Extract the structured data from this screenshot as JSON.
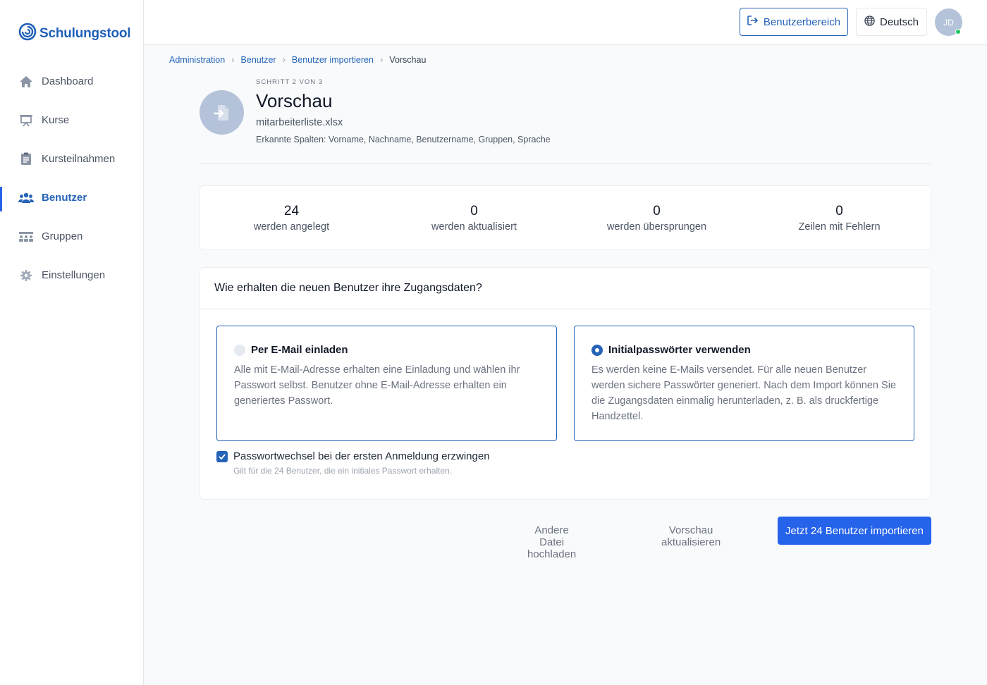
{
  "app": {
    "name": "Schulungstool"
  },
  "sidebar": {
    "items": [
      {
        "label": "Dashboard",
        "icon": "home-icon"
      },
      {
        "label": "Kurse",
        "icon": "presentation-icon"
      },
      {
        "label": "Kursteilnahmen",
        "icon": "clipboard-icon"
      },
      {
        "label": "Benutzer",
        "icon": "users-icon",
        "active": true
      },
      {
        "label": "Gruppen",
        "icon": "groups-icon"
      },
      {
        "label": "Einstellungen",
        "icon": "gear-icon"
      }
    ]
  },
  "topbar": {
    "user_area_label": "Benutzerbereich",
    "language_label": "Deutsch",
    "avatar_initials": "JD",
    "online_status_color": "#22c55e"
  },
  "breadcrumb": {
    "items": [
      "Administration",
      "Benutzer",
      "Benutzer importieren"
    ],
    "current": "Vorschau"
  },
  "header": {
    "step": "Schritt 2 von 3",
    "title": "Vorschau",
    "filename": "mitarbeiterliste.xlsx",
    "columns": "Erkannte Spalten: Vorname, Nachname, Benutzername, Gruppen, Sprache"
  },
  "stats": [
    {
      "value": "24",
      "label": "werden angelegt"
    },
    {
      "value": "0",
      "label": "werden aktualisiert"
    },
    {
      "value": "0",
      "label": "werden übersprungen"
    },
    {
      "value": "0",
      "label": "Zeilen mit Fehlern"
    }
  ],
  "credentials": {
    "question": "Wie erhalten die neuen Benutzer ihre Zugangsdaten?",
    "options": [
      {
        "title": "Per E-Mail einladen",
        "description": "Alle mit E-Mail-Adresse erhalten eine Einladung und wählen ihr Passwort selbst. Benutzer ohne E-Mail-Adresse erhalten ein generiertes Passwort.",
        "selected": false
      },
      {
        "title": "Initialpasswörter verwenden",
        "description": "Es werden keine E-Mails versendet. Für alle neuen Benutzer werden sichere Passwörter generiert. Nach dem Import können Sie die Zugangsdaten einmalig herunterladen, z. B. als druckfertige Handzettel.",
        "selected": true
      }
    ],
    "force_change": {
      "label": "Passwortwechsel bei der ersten Anmeldung erzwingen",
      "hint": "Gilt für die 24 Benutzer, die ein initiales Passwort erhalten.",
      "checked": true
    }
  },
  "actions": {
    "upload_other": "Andere Datei hochladen",
    "refresh_preview": "Vorschau aktualisieren",
    "import_now": "Jetzt 24 Benutzer importieren"
  },
  "colors": {
    "accent": "#2563eb",
    "brand": "#2060b8"
  }
}
